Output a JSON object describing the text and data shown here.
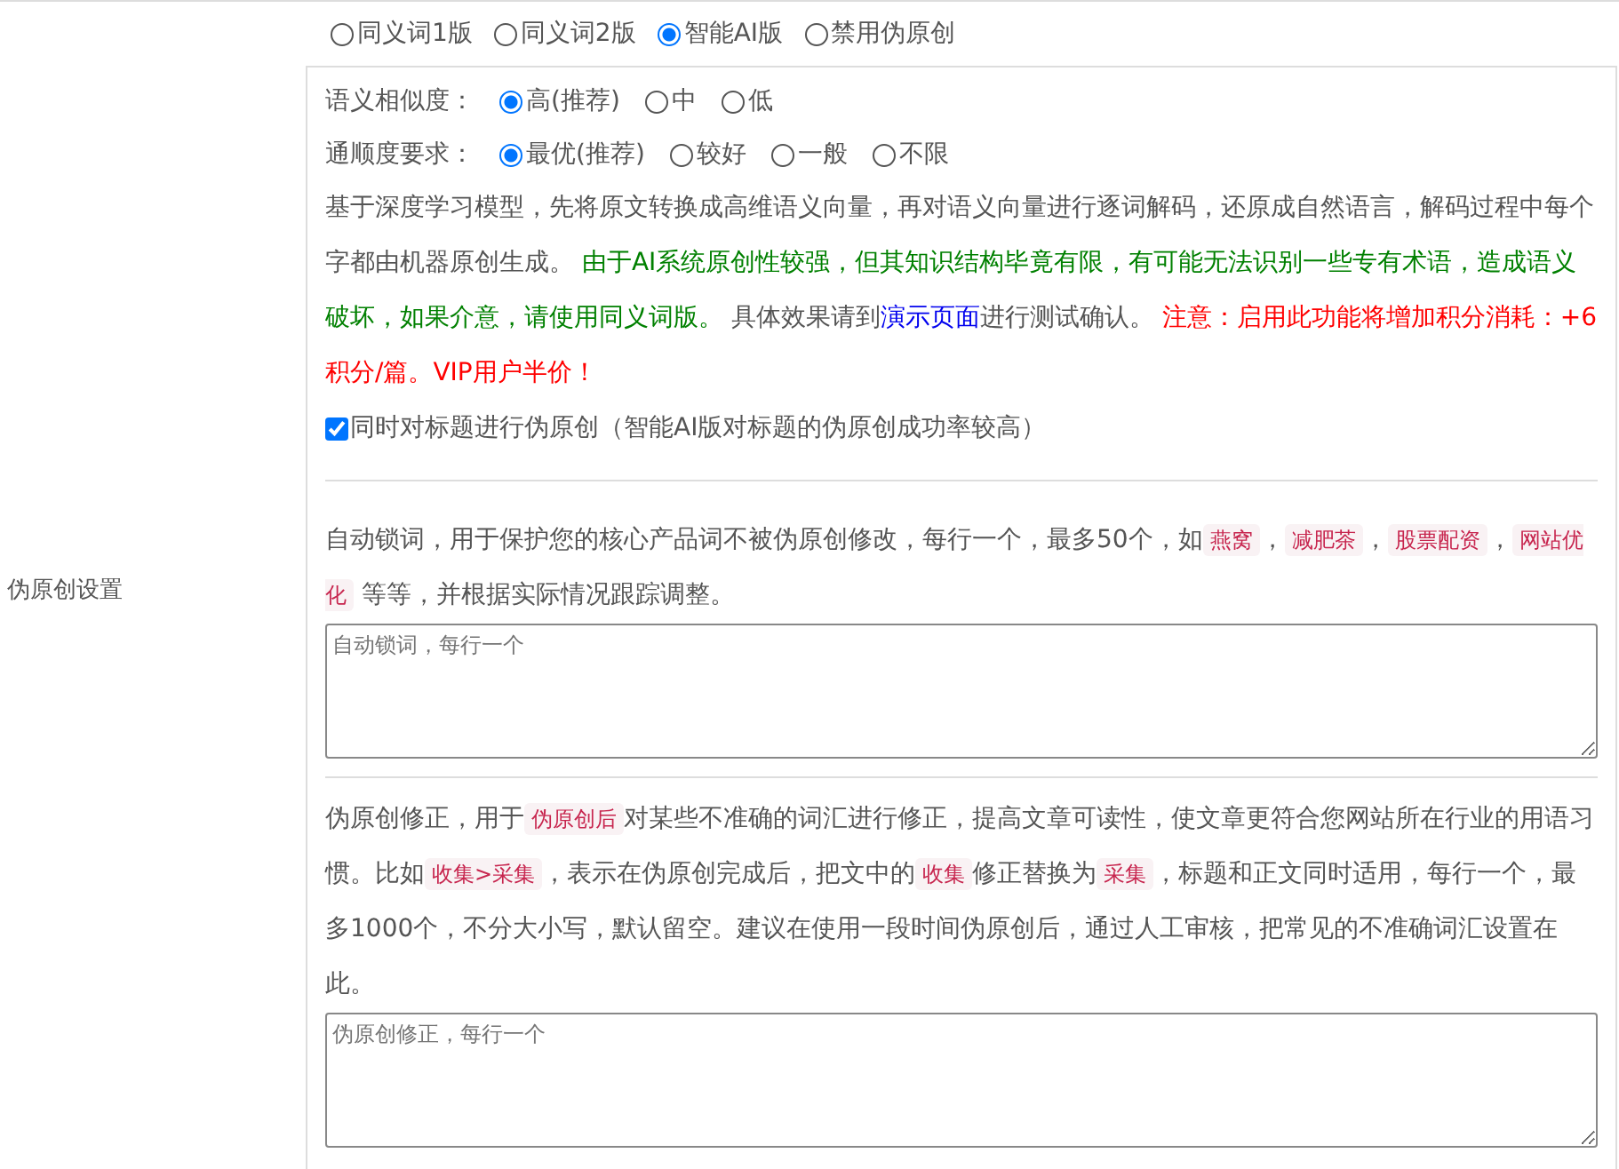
{
  "side_label": "伪原创设置",
  "modes": [
    {
      "label": "同义词1版",
      "selected": false
    },
    {
      "label": "同义词2版",
      "selected": false
    },
    {
      "label": "智能AI版",
      "selected": true
    },
    {
      "label": "禁用伪原创",
      "selected": false
    }
  ],
  "similarity": {
    "label": "语义相似度：",
    "options": [
      {
        "label": "高(推荐)",
        "selected": true
      },
      {
        "label": "中",
        "selected": false
      },
      {
        "label": "低",
        "selected": false
      }
    ]
  },
  "fluency": {
    "label": "通顺度要求：",
    "options": [
      {
        "label": "最优(推荐)",
        "selected": true
      },
      {
        "label": "较好",
        "selected": false
      },
      {
        "label": "一般",
        "selected": false
      },
      {
        "label": "不限",
        "selected": false
      }
    ]
  },
  "description": [
    {
      "kind": "text",
      "text": "基于深度学习模型，先将原文转换成高维语义向量，再对语义向量进行逐词解码，还原成自然语言，解码过程中每个字都由机器原创生成。 "
    },
    {
      "kind": "notice",
      "text": "由于AI系统原创性较强，但其知识结构毕竟有限，有可能无法识别一些专有术语，造成语义破坏，如果介意，请使用同义词版。"
    },
    {
      "kind": "text",
      "text": " 具体效果请到"
    },
    {
      "kind": "link",
      "text": "演示页面"
    },
    {
      "kind": "text",
      "text": "进行测试确认。 "
    },
    {
      "kind": "warning",
      "text": "注意：启用此功能将增加积分消耗：+6积分/篇。VIP用户半价！"
    }
  ],
  "title_option": {
    "label": "同时对标题进行伪原创（智能AI版对标题的伪原创成功率较高）",
    "checked": true
  },
  "lock_words": {
    "description": [
      {
        "kind": "text",
        "text": "自动锁词，用于保护您的核心产品词不被伪原创修改，每行一个，最多50个，如"
      },
      {
        "kind": "code",
        "text": "燕窝"
      },
      {
        "kind": "text",
        "text": "，"
      },
      {
        "kind": "code",
        "text": "减肥茶"
      },
      {
        "kind": "text",
        "text": "，"
      },
      {
        "kind": "code",
        "text": "股票配资"
      },
      {
        "kind": "text",
        "text": "，"
      },
      {
        "kind": "code",
        "text": "网站优化"
      },
      {
        "kind": "text",
        "text": " 等等，并根据实际情况跟踪调整。"
      }
    ],
    "placeholder": "自动锁词，每行一个"
  },
  "correction": {
    "description": [
      {
        "kind": "text",
        "text": "伪原创修正，用于"
      },
      {
        "kind": "code",
        "text": "伪原创后"
      },
      {
        "kind": "text",
        "text": "对某些不准确的词汇进行修正，提高文章可读性，使文章更符合您网站所在行业的用语习惯。比如"
      },
      {
        "kind": "code",
        "text": "收集>采集"
      },
      {
        "kind": "text",
        "text": "，表示在伪原创完成后，把文中的"
      },
      {
        "kind": "code",
        "text": "收集"
      },
      {
        "kind": "text",
        "text": "修正替换为"
      },
      {
        "kind": "code",
        "text": "采集"
      },
      {
        "kind": "text",
        "text": "，标题和正文同时适用，每行一个，最多1000个，不分大小写，默认留空。建议在使用一段时间伪原创后，通过人工审核，把常见的不准确词汇设置在此。"
      }
    ],
    "placeholder": "伪原创修正，每行一个"
  }
}
